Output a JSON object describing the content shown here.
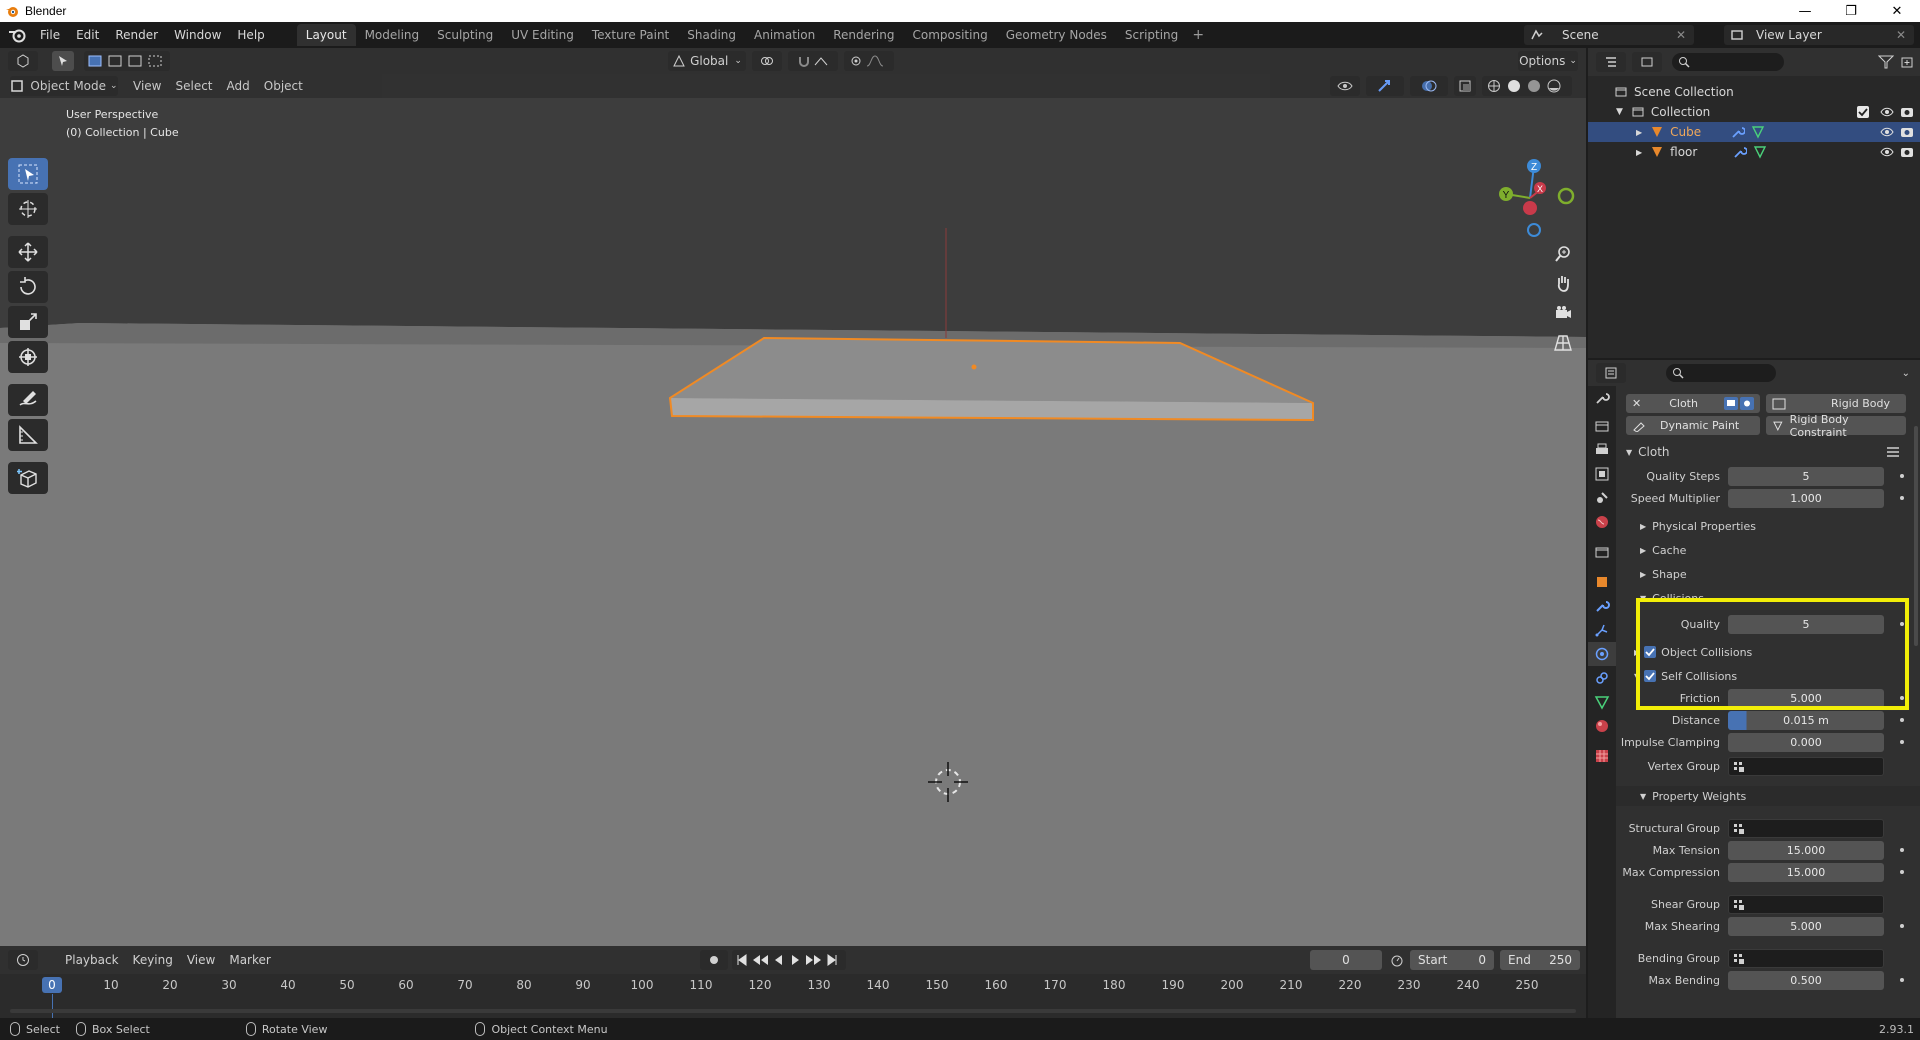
{
  "app": {
    "window_title": "Blender",
    "version": "2.93.1",
    "menus": [
      "File",
      "Edit",
      "Render",
      "Window",
      "Help"
    ],
    "workspaces": [
      "Layout",
      "Modeling",
      "Sculpting",
      "UV Editing",
      "Texture Paint",
      "Shading",
      "Animation",
      "Rendering",
      "Compositing",
      "Geometry Nodes",
      "Scripting"
    ],
    "active_workspace": "Layout",
    "scene_name": "Scene",
    "view_layer": "View Layer"
  },
  "viewport": {
    "transform_orientation": "Global",
    "options_label": "Options",
    "mode": "Object Mode",
    "menus": [
      "View",
      "Select",
      "Add",
      "Object"
    ],
    "overlay_line1": "User Perspective",
    "overlay_line2": "(0) Collection | Cube",
    "gizmo_axes": {
      "z": "Z",
      "y": "Y",
      "x": "X"
    },
    "colors": {
      "selection_outline": "#f08a24",
      "floor": "#7a7a7a",
      "background": "#3d3d3d"
    }
  },
  "timeline": {
    "menus": [
      "Playback",
      "Keying",
      "View",
      "Marker"
    ],
    "current_frame": "0",
    "start_label": "Start",
    "start_value": "0",
    "end_label": "End",
    "end_value": "250",
    "ruler_current": "0",
    "ruler_ticks": [
      "10",
      "20",
      "30",
      "40",
      "50",
      "60",
      "70",
      "80",
      "90",
      "100",
      "110",
      "120",
      "130",
      "140",
      "150",
      "160",
      "170",
      "180",
      "190",
      "200",
      "210",
      "220",
      "230",
      "240",
      "250"
    ]
  },
  "statusbar": {
    "select": "Select",
    "box_select": "Box Select",
    "rotate_view": "Rotate View",
    "context_menu": "Object Context Menu"
  },
  "outliner": {
    "scene_collection": "Scene Collection",
    "collection": "Collection",
    "objects": [
      {
        "name": "Cube",
        "selected": true
      },
      {
        "name": "floor",
        "selected": false
      }
    ]
  },
  "properties": {
    "physics_buttons": {
      "cloth": "Cloth",
      "rigid_body": "Rigid Body",
      "dynamic_paint": "Dynamic Paint",
      "rigid_body_constraint": "Rigid Body Constraint"
    },
    "cloth_panel": "Cloth",
    "quality_steps_label": "Quality Steps",
    "quality_steps_value": "5",
    "speed_multiplier_label": "Speed Multiplier",
    "speed_multiplier_value": "1.000",
    "physical_properties": "Physical Properties",
    "cache": "Cache",
    "shape": "Shape",
    "collisions": "Collisions",
    "collision_quality_label": "Quality",
    "collision_quality_value": "5",
    "object_collisions": "Object Collisions",
    "self_collisions": "Self Collisions",
    "friction_label": "Friction",
    "friction_value": "5.000",
    "distance_label": "Distance",
    "distance_value": "0.015 m",
    "impulse_clamping_label": "Impulse Clamping",
    "impulse_clamping_value": "0.000",
    "vertex_group_label": "Vertex Group",
    "property_weights": "Property Weights",
    "structural_group_label": "Structural Group",
    "max_tension_label": "Max Tension",
    "max_tension_value": "15.000",
    "max_compression_label": "Max Compression",
    "max_compression_value": "15.000",
    "shear_group_label": "Shear Group",
    "max_shearing_label": "Max Shearing",
    "max_shearing_value": "5.000",
    "bending_group_label": "Bending Group",
    "max_bending_label": "Max Bending",
    "max_bending_value": "0.500",
    "colors": {
      "highlight_box": "#f2ee08",
      "accent": "#4772b3"
    }
  }
}
